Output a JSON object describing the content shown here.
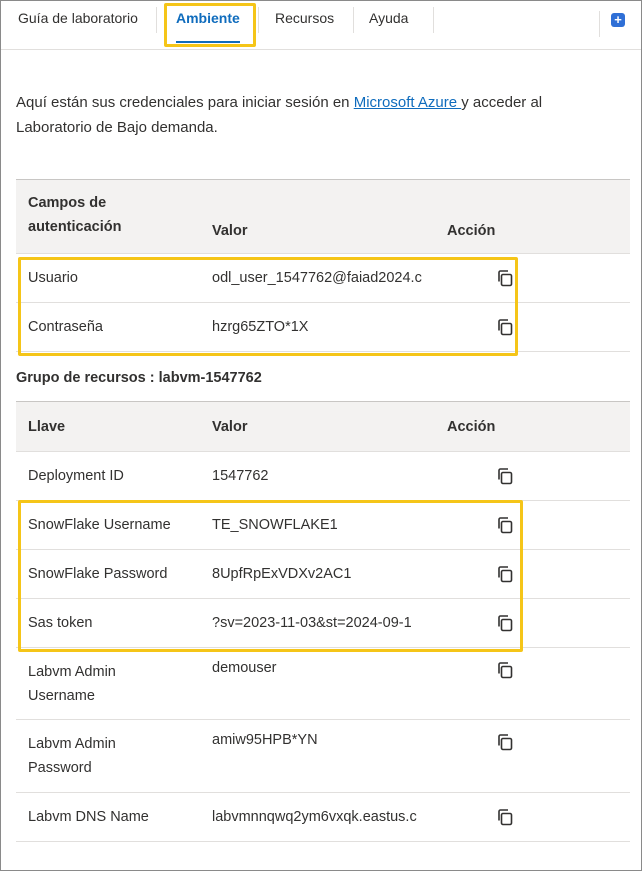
{
  "tabs": [
    {
      "label": "Guía de laboratorio"
    },
    {
      "label": "Ambiente"
    },
    {
      "label": "Recursos"
    },
    {
      "label": "Ayuda"
    }
  ],
  "intro": {
    "before": "Aquí están sus credenciales para iniciar sesión en ",
    "link": "Microsoft Azure ",
    "after": "y acceder al Laboratorio de Bajo demanda."
  },
  "auth_table": {
    "headers": [
      "Campos de autenticación",
      "Valor",
      "Acción"
    ],
    "rows": [
      {
        "label": "Usuario",
        "value": "odl_user_1547762@faiad2024.c"
      },
      {
        "label": "Contraseña",
        "value": "hzrg65ZTO*1X"
      }
    ]
  },
  "resource_group": {
    "title": "Grupo de recursos : labvm-1547762"
  },
  "resource_table": {
    "headers": [
      "Llave",
      "Valor",
      "Acción"
    ],
    "rows": [
      {
        "label": "Deployment ID",
        "value": "1547762"
      },
      {
        "label": "SnowFlake Username",
        "value": "TE_SNOWFLAKE1"
      },
      {
        "label": "SnowFlake Password",
        "value": "8UpfRpExVDXv2AC1"
      },
      {
        "label": "Sas token",
        "value": "?sv=2023-11-03&st=2024-09-1"
      },
      {
        "label": "Labvm Admin Username",
        "value": "demouser"
      },
      {
        "label": "Labvm Admin Password",
        "value": "amiw95HPB*YN"
      },
      {
        "label": "Labvm DNS Name",
        "value": "labvmnnqwq2ym6vxqk.eastus.c"
      }
    ]
  },
  "colors": {
    "accent": "#0f6cbd",
    "highlight": "#f5c518"
  },
  "icons": {
    "copy": "copy-icon",
    "corner": "expand-icon"
  }
}
